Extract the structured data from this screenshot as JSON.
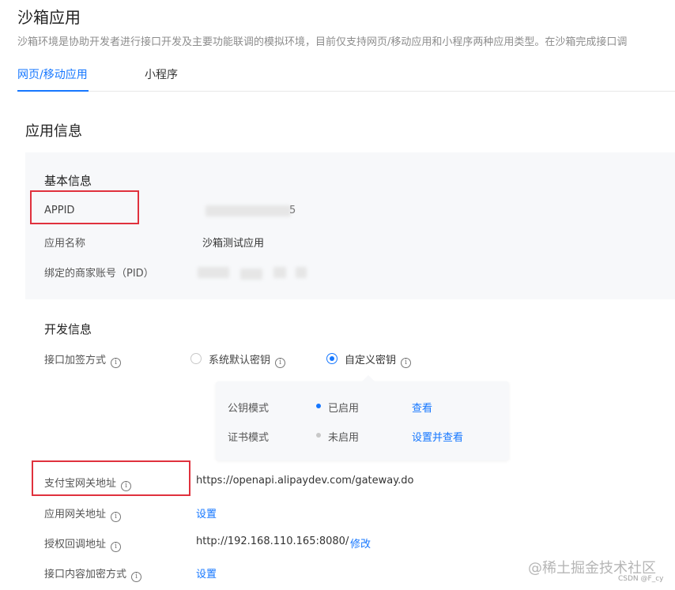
{
  "page": {
    "title": "沙箱应用",
    "description": "沙箱环境是协助开发者进行接口开发及主要功能联调的模拟环境，目前仅支持网页/移动应用和小程序两种应用类型。在沙箱完成接口调"
  },
  "tabs": [
    {
      "label": "网页/移动应用",
      "active": true
    },
    {
      "label": "小程序",
      "active": false
    }
  ],
  "app_info": {
    "title": "应用信息",
    "basic": {
      "title": "基本信息",
      "appid_label": "APPID",
      "appid_value_suffix": "5",
      "app_name_label": "应用名称",
      "app_name_value": "沙箱测试应用",
      "pid_label": "绑定的商家账号（PID）"
    },
    "dev": {
      "title": "开发信息",
      "sign_method_label": "接口加签方式",
      "option_default": "系统默认密钥",
      "option_custom": "自定义密钥",
      "popover": {
        "row1_label": "公钥模式",
        "row1_status": "已启用",
        "row1_action": "查看",
        "row2_label": "证书模式",
        "row2_status": "未启用",
        "row2_action": "设置并查看"
      },
      "gateway_label": "支付宝网关地址",
      "gateway_value": "https://openapi.alipaydev.com/gateway.do",
      "app_gateway_label": "应用网关地址",
      "app_gateway_action": "设置",
      "callback_label": "授权回调地址",
      "callback_value": "http://192.168.110.165:8080/",
      "callback_action": "修改",
      "encrypt_label": "接口内容加密方式",
      "encrypt_action": "设置"
    }
  },
  "watermark": {
    "main": "@稀土掘金技术社区",
    "sub": "CSDN @F_cy"
  },
  "colors": {
    "accent": "#1677ff",
    "highlight": "#e0313d",
    "enabled_dot": "#1677ff",
    "disabled_dot": "#c8c8c8"
  }
}
